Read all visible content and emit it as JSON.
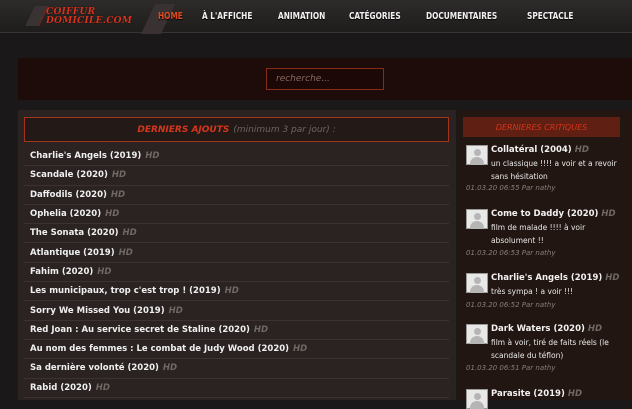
{
  "logo": {
    "line1": "COIFFUR",
    "line2": "DOMICILE.COM"
  },
  "nav": [
    {
      "label": "HOME",
      "active": true
    },
    {
      "label": "À L'AFFICHE"
    },
    {
      "label": "ANIMATION"
    },
    {
      "label": "CATÉGORIES"
    },
    {
      "label": "DOCUMENTAIRES"
    },
    {
      "label": "SPECTACLE"
    }
  ],
  "search": {
    "placeholder": "recherche..."
  },
  "latest": {
    "title": "DERNIERS AJOUTS",
    "subtitle": "(minimum 3 par jour) :",
    "items": [
      {
        "title": "Charlie's Angels (2019)",
        "quality": "HD"
      },
      {
        "title": "Scandale (2020)",
        "quality": "HD"
      },
      {
        "title": "Daffodils (2020)",
        "quality": "HD"
      },
      {
        "title": "Ophelia (2020)",
        "quality": "HD"
      },
      {
        "title": "The Sonata (2020)",
        "quality": "HD"
      },
      {
        "title": "Atlantique (2019)",
        "quality": "HD"
      },
      {
        "title": "Fahim (2020)",
        "quality": "HD"
      },
      {
        "title": "Les municipaux, trop c'est trop ! (2019)",
        "quality": "HD"
      },
      {
        "title": "Sorry We Missed You (2019)",
        "quality": "HD"
      },
      {
        "title": "Red Joan : Au service secret de Staline (2020)",
        "quality": "HD"
      },
      {
        "title": "Au nom des femmes : Le combat de Judy Wood (2020)",
        "quality": "HD"
      },
      {
        "title": "Sa dernière volonté (2020)",
        "quality": "HD"
      },
      {
        "title": "Rabid (2020)",
        "quality": "HD"
      }
    ]
  },
  "critiques": {
    "title": "DERNIERES CRITIQUES",
    "items": [
      {
        "title": "Collatéral (2004)",
        "quality": "HD",
        "text": "un classique !!!! a voir et a revoir sans hésitation",
        "meta": "01.03.20 06:55 Par nathy"
      },
      {
        "title": "Come to Daddy (2020)",
        "quality": "HD",
        "text": "film de malade !!!! à voir absolument !!",
        "meta": "01.03.20 06:53 Par nathy"
      },
      {
        "title": "Charlie's Angels (2019)",
        "quality": "HD",
        "text": "très sympa ! a voir !!!",
        "meta": "01.03.20 06:52 Par nathy"
      },
      {
        "title": "Dark Waters (2020)",
        "quality": "HD",
        "text": "film à voir, tiré de faits réels (le scandale du téflon)",
        "meta": "01.03.20 06:51 Par nathy"
      },
      {
        "title": "Parasite (2019)",
        "quality": "HD",
        "text": "",
        "meta": ""
      }
    ]
  }
}
